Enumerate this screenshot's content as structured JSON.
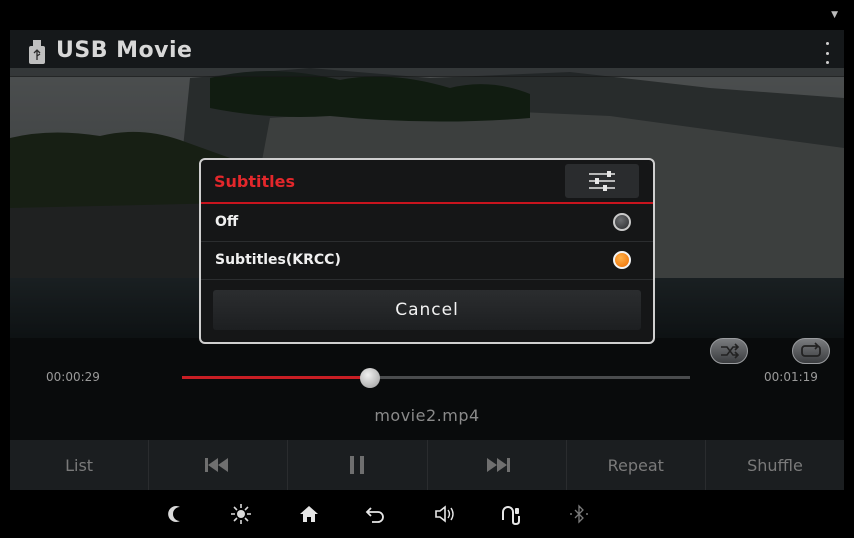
{
  "app": {
    "title": "USB Movie"
  },
  "dialog": {
    "title": "Subtitles",
    "options": [
      {
        "label": "Off",
        "selected": false
      },
      {
        "label": "Subtitles(KRCC)",
        "selected": true
      }
    ],
    "cancel_label": "Cancel"
  },
  "player": {
    "elapsed": "00:00:29",
    "duration": "00:01:19",
    "progress_fraction": 0.37,
    "filename": "movie2.mp4"
  },
  "controls": [
    "List",
    "previous-icon",
    "pause-icon",
    "next-icon",
    "Repeat",
    "Shuffle"
  ],
  "control_labels": {
    "list": "List",
    "repeat": "Repeat",
    "shuffle": "Shuffle"
  },
  "system_bar": [
    "moon-icon",
    "brightness-icon",
    "home-icon",
    "back-icon",
    "volume-icon",
    "phone-icon",
    "bluetooth-icon"
  ],
  "colors": {
    "accent_red": "#e3272b",
    "radio_selected": "#f07800"
  }
}
